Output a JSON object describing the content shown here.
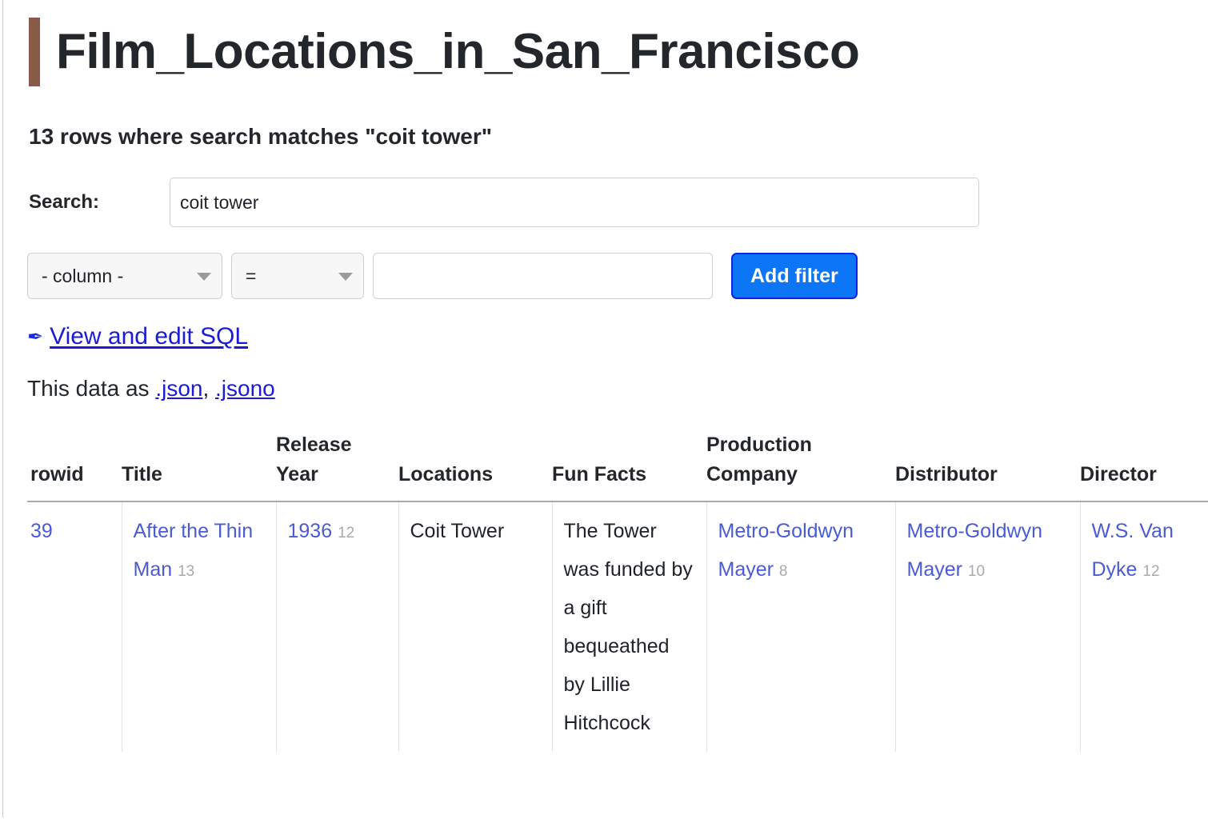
{
  "page": {
    "title": "Film_Locations_in_San_Francisco",
    "accent_color": "#8a5a49",
    "row_count_heading": "13 rows where search matches \"coit tower\""
  },
  "search": {
    "label": "Search:",
    "value": "coit tower",
    "placeholder": ""
  },
  "filter": {
    "column_select": "- column -",
    "operator_select": "=",
    "value": "",
    "value_placeholder": "",
    "add_button": "Add filter"
  },
  "sql": {
    "icon": "pencil-icon",
    "link_text": "View and edit SQL"
  },
  "export": {
    "prefix": "This data as ",
    "links": [
      {
        "label": ".json"
      },
      {
        "label": ".jsono"
      }
    ],
    "separator": ", "
  },
  "table": {
    "columns": [
      "rowid",
      "Title",
      "Release Year",
      "Locations",
      "Fun Facts",
      "Production Company",
      "Distributor",
      "Director"
    ],
    "rows": [
      {
        "rowid": "39",
        "title": "After the Thin Man",
        "title_count": "13",
        "release_year": "1936",
        "release_year_count": "12",
        "locations": "Coit Tower",
        "fun_facts": "The Tower was funded by a gift bequeathed by Lillie Hitchcock",
        "production_company": "Metro-Goldwyn Mayer",
        "production_company_count": "8",
        "distributor": "Metro-Goldwyn Mayer",
        "distributor_count": "10",
        "director": "W.S. Van Dyke",
        "director_count": "12"
      }
    ]
  }
}
